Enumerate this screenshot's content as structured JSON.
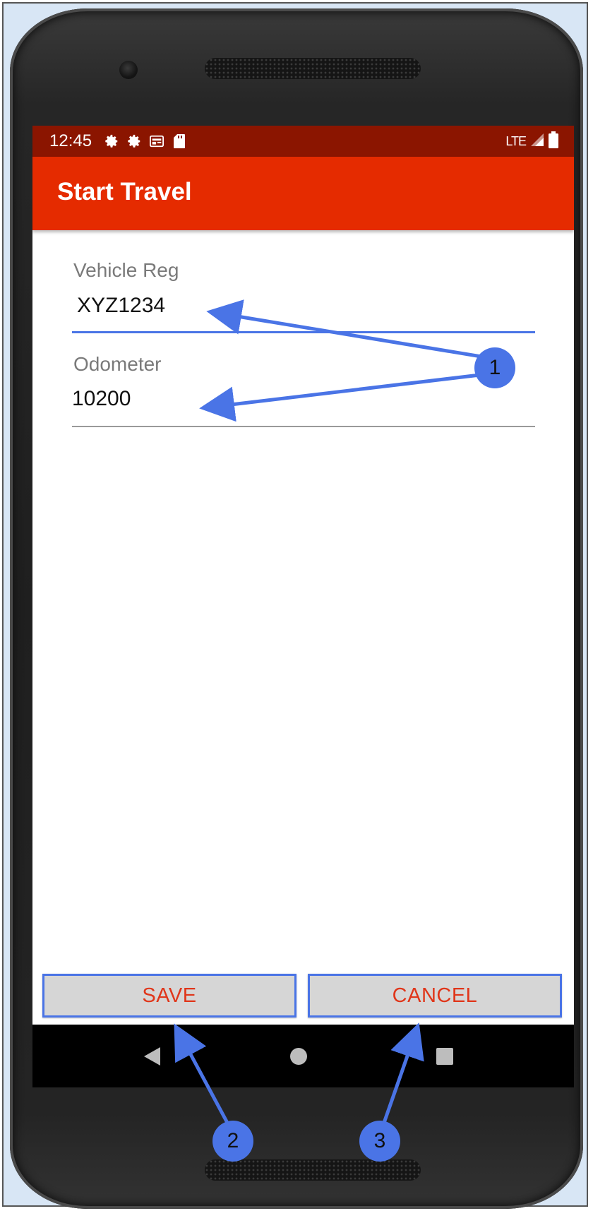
{
  "status_bar": {
    "time": "12:45",
    "left_icons": [
      "gear-icon",
      "gear-icon",
      "news-icon",
      "sd-card-icon"
    ],
    "network_label": "LTE",
    "right_icons": [
      "signal-icon",
      "battery-icon"
    ]
  },
  "app_bar": {
    "title": "Start Travel",
    "color": "#e52b00",
    "status_color": "#8b1500"
  },
  "form": {
    "vehicle_reg": {
      "label": "Vehicle Reg",
      "value": "XYZ1234"
    },
    "odometer": {
      "label": "Odometer",
      "value": "10200"
    }
  },
  "buttons": {
    "save_label": "SAVE",
    "cancel_label": "CANCEL",
    "text_color": "#e0361a"
  },
  "nav_bar": {
    "icons": [
      "back-triangle-icon",
      "home-circle-icon",
      "recents-square-icon"
    ]
  },
  "annotations": {
    "color": "#4a74e6",
    "badges": [
      {
        "label": "1"
      },
      {
        "label": "2"
      },
      {
        "label": "3"
      }
    ]
  }
}
